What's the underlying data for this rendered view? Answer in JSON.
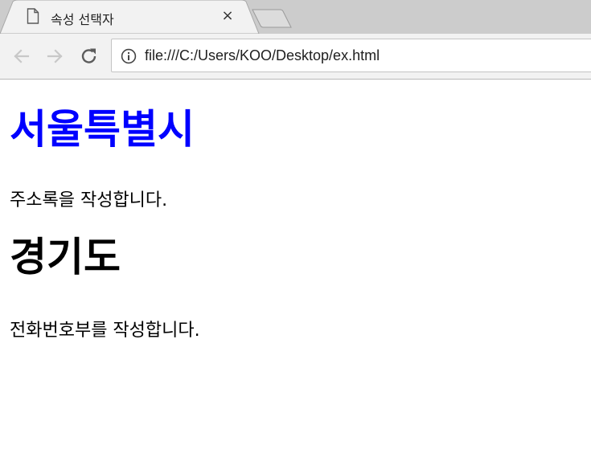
{
  "browser": {
    "tab": {
      "title": "속성 선택자",
      "close_symbol": "×",
      "icon": "document-icon"
    },
    "toolbar": {
      "back_icon": "arrow-left-icon",
      "forward_icon": "arrow-right-icon",
      "reload_icon": "reload-icon",
      "info_icon": "info-icon",
      "url": "file:///C:/Users/KOO/Desktop/ex.html"
    }
  },
  "page": {
    "heading1": "서울특별시",
    "heading1_color": "#0000ff",
    "paragraph1": "주소록을 작성합니다.",
    "heading2": "경기도",
    "heading2_color": "#000000",
    "paragraph2": "전화번호부를 작성합니다."
  }
}
